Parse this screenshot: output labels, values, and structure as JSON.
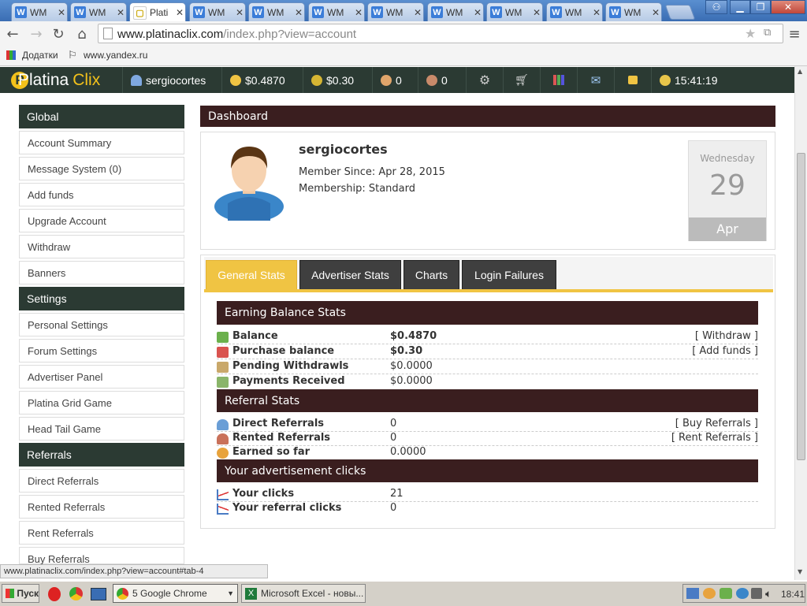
{
  "browser": {
    "tabs": [
      {
        "label": "WM",
        "active": false
      },
      {
        "label": "WM",
        "active": false
      },
      {
        "label": "Plati",
        "active": true
      },
      {
        "label": "WM",
        "active": false
      },
      {
        "label": "WM",
        "active": false
      },
      {
        "label": "WM",
        "active": false
      },
      {
        "label": "WM",
        "active": false
      },
      {
        "label": "WM",
        "active": false
      },
      {
        "label": "WM",
        "active": false
      },
      {
        "label": "WM",
        "active": false
      },
      {
        "label": "WM",
        "active": false
      }
    ],
    "url_domain": "www.platinaclix.com",
    "url_path": "/index.php?view=account",
    "bookmarks": {
      "apps": "Додатки",
      "yandex": "www.yandex.ru"
    },
    "status_url": "www.platinaclix.com/index.php?view=account#tab-4"
  },
  "header": {
    "logo_a": "Platina",
    "logo_b": "Clix",
    "username": "sergiocortes",
    "balance": "$0.4870",
    "purchase": "$0.30",
    "referrals_direct": "0",
    "referrals_rented": "0",
    "clock": "15:41:19"
  },
  "sidebar": {
    "global_title": "Global",
    "global_items": [
      "Account Summary",
      "Message System (0)",
      "Add funds",
      "Upgrade Account",
      "Withdraw",
      "Banners"
    ],
    "settings_title": "Settings",
    "settings_items": [
      "Personal Settings",
      "Forum Settings",
      "Advertiser Panel",
      "Platina Grid Game",
      "Head Tail Game"
    ],
    "referrals_title": "Referrals",
    "referrals_items": [
      "Direct Referrals",
      "Rented Referrals",
      "Rent Referrals",
      "Buy Referrals"
    ]
  },
  "dashboard": {
    "title": "Dashboard",
    "username": "sergiocortes",
    "member_since": "Member Since: Apr 28, 2015",
    "membership": "Membership: Standard",
    "date": {
      "weekday": "Wednesday",
      "day": "29",
      "month": "Apr"
    }
  },
  "tabs": [
    "General Stats",
    "Advertiser Stats",
    "Charts",
    "Login Failures"
  ],
  "earning": {
    "title": "Earning Balance Stats",
    "rows": [
      {
        "label": "Balance",
        "value": "$0.4870",
        "action": "[ Withdraw ]",
        "bold": true
      },
      {
        "label": "Purchase balance",
        "value": "$0.30",
        "action": "[ Add funds ]",
        "bold": true
      },
      {
        "label": "Pending Withdrawls",
        "value": "$0.0000",
        "action": ""
      },
      {
        "label": "Payments Received",
        "value": "$0.0000",
        "action": ""
      }
    ]
  },
  "referral": {
    "title": "Referral Stats",
    "rows": [
      {
        "label": "Direct Referrals",
        "value": "0",
        "action": "[ Buy Referrals ]"
      },
      {
        "label": "Rented Referrals",
        "value": "0",
        "action": "[ Rent Referrals ]"
      },
      {
        "label": "Earned so far",
        "value": "0.0000",
        "action": ""
      }
    ]
  },
  "clicks": {
    "title": "Your advertisement clicks",
    "rows": [
      {
        "label": "Your clicks",
        "value": "21"
      },
      {
        "label": "Your referral clicks",
        "value": "0"
      }
    ]
  },
  "taskbar": {
    "start": "Пуск",
    "chrome": "5 Google Chrome",
    "excel": "Microsoft Excel - новы...",
    "time": "18:41"
  },
  "colors": {
    "header_bg": "#2b3a33",
    "bar_bg": "#3a1e1f",
    "tab_active": "#f0c443",
    "tab_inactive": "#3f3f3f"
  }
}
